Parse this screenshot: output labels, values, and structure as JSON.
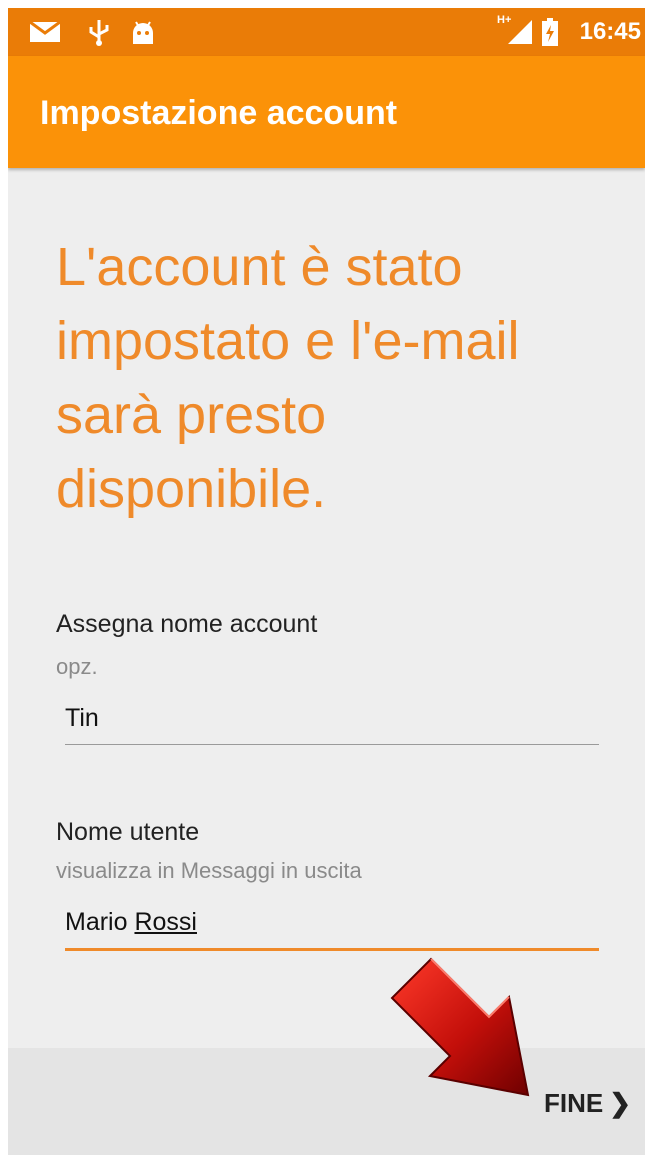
{
  "status_bar": {
    "time": "16:45",
    "network": "H+",
    "icons": [
      "mail-icon",
      "usb-icon",
      "android-icon",
      "signal-icon",
      "battery-icon"
    ],
    "background_color": "#ea7c07"
  },
  "app_bar": {
    "title": "Impostazione account",
    "background_color": "#fb9208"
  },
  "main": {
    "headline": "L'account è stato impostato e l'e-mail sarà presto disponibile.",
    "accent_color": "#ef8a2a",
    "fields": [
      {
        "label": "Assegna nome account",
        "hint": "opz.",
        "value": "Tin"
      },
      {
        "label": "Nome utente",
        "hint": "visualizza in Messaggi in uscita",
        "value_first": "Mario",
        "value_second": "Rossi"
      }
    ]
  },
  "footer": {
    "next_label": "FINE",
    "next_icon": "chevron-right-icon"
  }
}
